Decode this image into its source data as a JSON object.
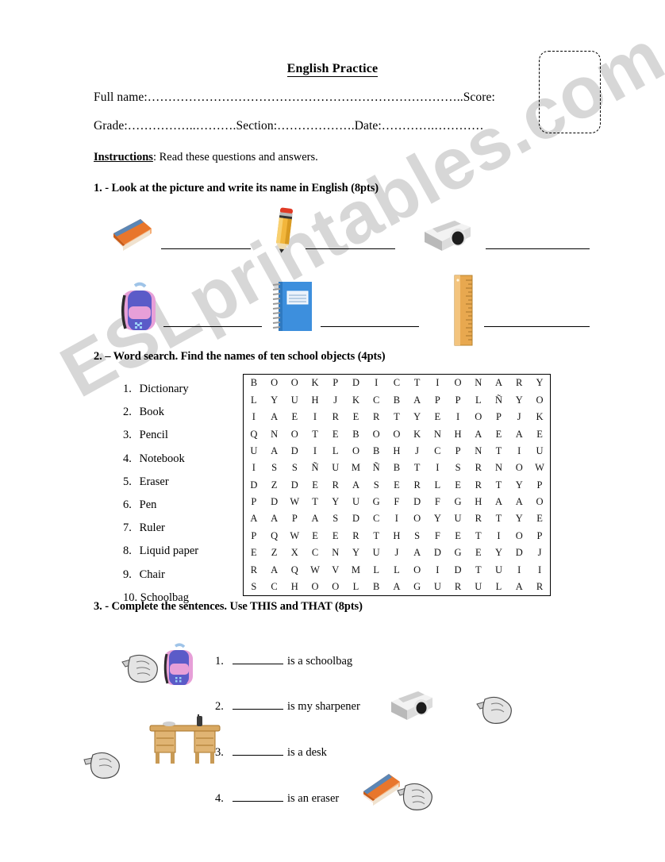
{
  "document": {
    "title": "English Practice",
    "watermark": "ESLprintables.com"
  },
  "header": {
    "full_name_label": "Full name:",
    "full_name_dots": "…………………………………………………………………..",
    "score_label": "Score:",
    "grade_label": "Grade:",
    "grade_dots": "……………..……….",
    "section_label": "Section:",
    "section_dots": "……………….",
    "date_label": "Date:",
    "date_dots": "………….…………",
    "score_box": ""
  },
  "instructions": {
    "label": "Instructions",
    "colon": ":",
    "text": "Read these questions and answers."
  },
  "exercises": [
    {
      "heading": "1. - Look at the picture and write its name in English (8pts)",
      "items": [
        {
          "icon": "eraser-image",
          "answer": ""
        },
        {
          "icon": "pencil-image",
          "answer": ""
        },
        {
          "icon": "sharpener-image",
          "answer": ""
        },
        {
          "icon": "schoolbag-image",
          "answer": ""
        },
        {
          "icon": "notebook-image",
          "answer": ""
        },
        {
          "icon": "ruler-image",
          "answer": ""
        }
      ]
    },
    {
      "heading": "2. – Word search. Find the names of ten school objects (4pts)",
      "words": [
        {
          "num": "1.",
          "word": "Dictionary"
        },
        {
          "num": "2.",
          "word": "Book"
        },
        {
          "num": "3.",
          "word": "Pencil"
        },
        {
          "num": "4.",
          "word": "Notebook"
        },
        {
          "num": "5.",
          "word": "Eraser"
        },
        {
          "num": "6.",
          "word": "Pen"
        },
        {
          "num": "7.",
          "word": "Ruler"
        },
        {
          "num": "8.",
          "word": "Liquid paper"
        },
        {
          "num": "9.",
          "word": "Chair"
        },
        {
          "num": "10.",
          "word": "Schoolbag"
        }
      ],
      "grid": [
        [
          "B",
          "O",
          "O",
          "K",
          "P",
          "D",
          "I",
          "C",
          "T",
          "I",
          "O",
          "N",
          "A",
          "R",
          "Y"
        ],
        [
          "L",
          "Y",
          "U",
          "H",
          "J",
          "K",
          "C",
          "B",
          "A",
          "P",
          "P",
          "L",
          "Ñ",
          "Y",
          "O"
        ],
        [
          "I",
          "A",
          "E",
          "I",
          "R",
          "E",
          "R",
          "T",
          "Y",
          "E",
          "I",
          "O",
          "P",
          "J",
          "K"
        ],
        [
          "Q",
          "N",
          "O",
          "T",
          "E",
          "B",
          "O",
          "O",
          "K",
          "N",
          "H",
          "A",
          "E",
          "A",
          "E"
        ],
        [
          "U",
          "A",
          "D",
          "I",
          "L",
          "O",
          "B",
          "H",
          "J",
          "C",
          "P",
          "N",
          "T",
          "I",
          "U"
        ],
        [
          "I",
          "S",
          "S",
          "Ñ",
          "U",
          "M",
          "Ñ",
          "B",
          "T",
          "I",
          "S",
          "R",
          "N",
          "O",
          "W"
        ],
        [
          "D",
          "Z",
          "D",
          "E",
          "R",
          "A",
          "S",
          "E",
          "R",
          "L",
          "E",
          "R",
          "T",
          "Y",
          "P"
        ],
        [
          "P",
          "D",
          "W",
          "T",
          "Y",
          "U",
          "G",
          "F",
          "D",
          "F",
          "G",
          "H",
          "A",
          "A",
          "O"
        ],
        [
          "A",
          "A",
          "P",
          "A",
          "S",
          "D",
          "C",
          "I",
          "O",
          "Y",
          "U",
          "R",
          "T",
          "Y",
          "E"
        ],
        [
          "P",
          "Q",
          "W",
          "E",
          "E",
          "R",
          "T",
          "H",
          "S",
          "F",
          "E",
          "T",
          "I",
          "O",
          "P"
        ],
        [
          "E",
          "Z",
          "X",
          "C",
          "N",
          "Y",
          "U",
          "J",
          "A",
          "D",
          "G",
          "E",
          "Y",
          "D",
          "J"
        ],
        [
          "R",
          "A",
          "Q",
          "W",
          "V",
          "M",
          "L",
          "L",
          "O",
          "I",
          "D",
          "T",
          "U",
          "I",
          "I"
        ],
        [
          "S",
          "C",
          "H",
          "O",
          "O",
          "L",
          "B",
          "A",
          "G",
          "U",
          "R",
          "U",
          "L",
          "A",
          "R"
        ]
      ]
    },
    {
      "heading": "3. - Complete the sentences. Use THIS and THAT (8pts)",
      "sentences": [
        {
          "num": "1.",
          "blank": "",
          "text": "is a schoolbag"
        },
        {
          "num": "2.",
          "blank": "",
          "text": "is my sharpener"
        },
        {
          "num": "3.",
          "blank": "",
          "text": "is a desk"
        },
        {
          "num": "4.",
          "blank": "",
          "text": "is an eraser"
        }
      ],
      "illustrations": [
        "pointing-hand-image",
        "schoolbag-image",
        "sharpener-image",
        "pointing-hand-image",
        "desk-image",
        "pointing-hand-image",
        "eraser-image",
        "pointing-hand-image"
      ]
    }
  ],
  "colors": {
    "eraser_blue": "#5b86b5",
    "eraser_orange": "#e8762c",
    "pencil_yellow": "#f2b63c",
    "pencil_red": "#e03a25",
    "sharpener_gray": "#d8d8d8",
    "bag_pink": "#e79fd8",
    "bag_blue": "#5b5bc8",
    "notebook_blue": "#3d8fdd",
    "ruler_tan": "#e8a84f",
    "desk_wood": "#d8a861",
    "watermark_gray": "#c9c9c9"
  }
}
